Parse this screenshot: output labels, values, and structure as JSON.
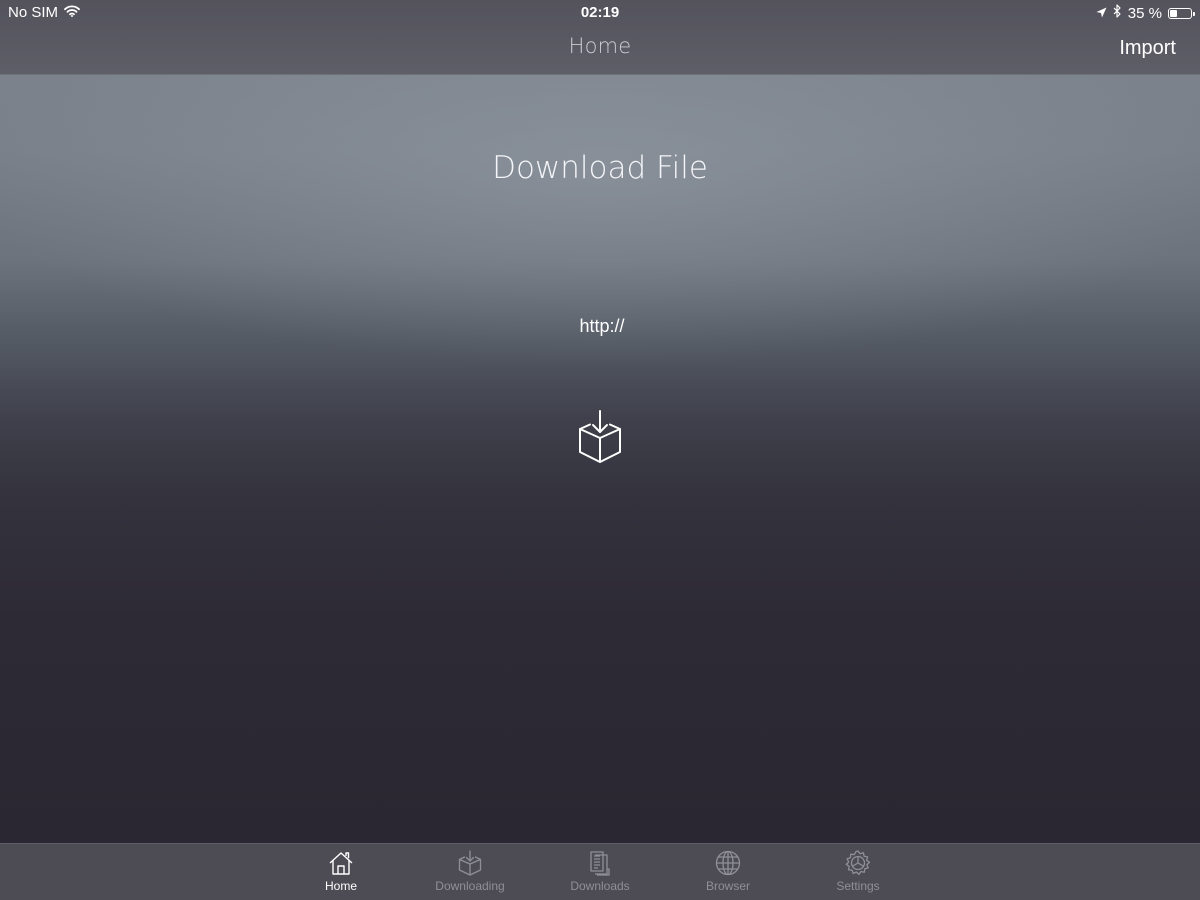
{
  "status_bar": {
    "carrier": "No SIM",
    "time": "02:19",
    "battery_text": "35 %",
    "battery_level": 0.35,
    "icons": [
      "wifi-icon",
      "location-arrow-icon",
      "bluetooth-icon",
      "battery-icon"
    ]
  },
  "nav": {
    "title": "Home",
    "import_label": "Import"
  },
  "main": {
    "title": "Download File",
    "url_placeholder": "http://",
    "download_icon": "download-box-icon"
  },
  "tabs": [
    {
      "label": "Home",
      "icon": "home-icon",
      "active": true
    },
    {
      "label": "Downloading",
      "icon": "box-download-icon",
      "active": false
    },
    {
      "label": "Downloads",
      "icon": "documents-icon",
      "active": false
    },
    {
      "label": "Browser",
      "icon": "globe-icon",
      "active": false
    },
    {
      "label": "Settings",
      "icon": "gear-icon",
      "active": false
    }
  ],
  "colors": {
    "active_tab": "#ffffff",
    "inactive_tab": "#8f8f97",
    "tab_bar_background": "#4d4c55",
    "nav_bar_background": "#5a5961"
  }
}
